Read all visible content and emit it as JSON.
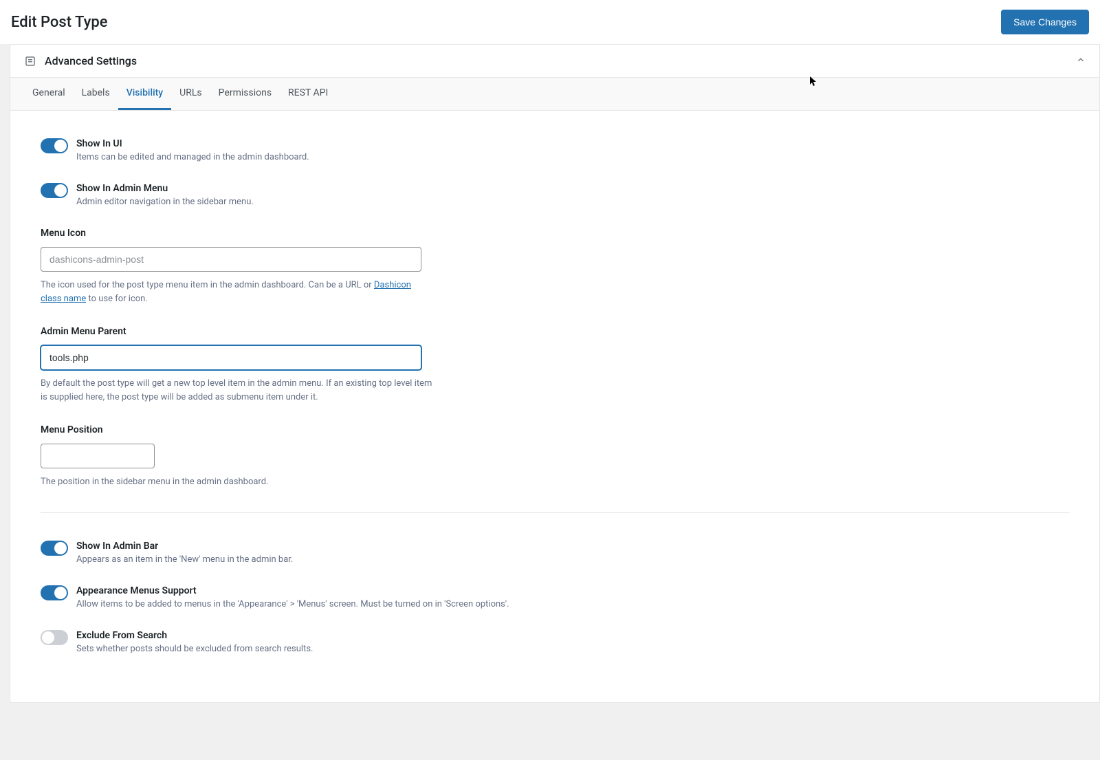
{
  "header": {
    "title": "Edit Post Type",
    "save_label": "Save Changes"
  },
  "panel": {
    "title": "Advanced Settings"
  },
  "tabs": [
    {
      "label": "General"
    },
    {
      "label": "Labels"
    },
    {
      "label": "Visibility"
    },
    {
      "label": "URLs"
    },
    {
      "label": "Permissions"
    },
    {
      "label": "REST API"
    }
  ],
  "fields": {
    "show_in_ui": {
      "label": "Show In UI",
      "desc": "Items can be edited and managed in the admin dashboard."
    },
    "show_in_admin_menu": {
      "label": "Show In Admin Menu",
      "desc": "Admin editor navigation in the sidebar menu."
    },
    "menu_icon": {
      "label": "Menu Icon",
      "placeholder": "dashicons-admin-post",
      "desc_prefix": "The icon used for the post type menu item in the admin dashboard. Can be a URL or ",
      "link_text": "Dashicon class name",
      "desc_suffix": " to use for icon."
    },
    "admin_menu_parent": {
      "label": "Admin Menu Parent",
      "value": "tools.php",
      "desc": "By default the post type will get a new top level item in the admin menu. If an existing top level item is supplied here, the post type will be added as submenu item under it."
    },
    "menu_position": {
      "label": "Menu Position",
      "desc": "The position in the sidebar menu in the admin dashboard."
    },
    "show_in_admin_bar": {
      "label": "Show In Admin Bar",
      "desc": "Appears as an item in the 'New' menu in the admin bar."
    },
    "appearance_menus": {
      "label": "Appearance Menus Support",
      "desc": "Allow items to be added to menus in the 'Appearance' > 'Menus' screen. Must be turned on in 'Screen options'."
    },
    "exclude_from_search": {
      "label": "Exclude From Search",
      "desc": "Sets whether posts should be excluded from search results."
    }
  }
}
